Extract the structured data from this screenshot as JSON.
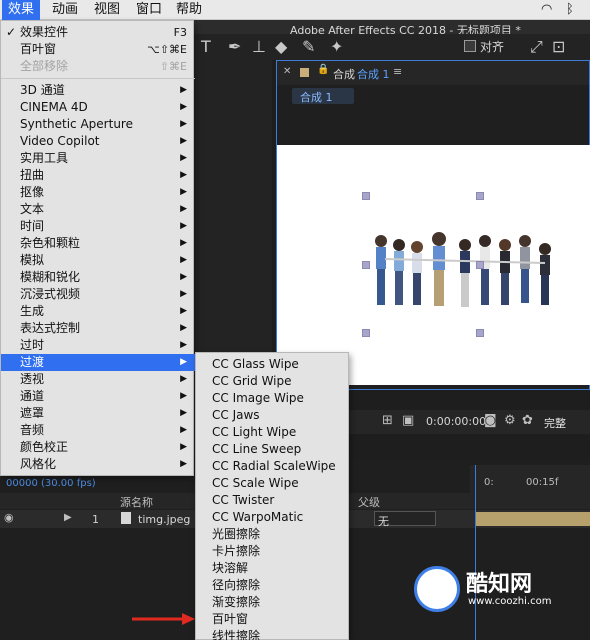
{
  "menubar": {
    "items": [
      "效果",
      "动画",
      "视图",
      "窗口",
      "帮助"
    ],
    "active_index": 0,
    "right_glyphs": [
      "wifi-icon",
      "bluetooth-icon"
    ]
  },
  "window": {
    "title": "Adobe After Effects CC 2018 - 无标题项目 *"
  },
  "toolbar": {
    "align_label": "对齐",
    "align_checked": true
  },
  "effects_menu": {
    "items": [
      {
        "label": "效果控件",
        "shortcut": "F3",
        "checked": true
      },
      {
        "label": "百叶窗",
        "shortcut": "⌥⇧⌘E"
      },
      {
        "label": "全部移除",
        "shortcut": "⇧⌘E",
        "disabled": true
      },
      {
        "label": "3D 通道",
        "submenu": true
      },
      {
        "label": "CINEMA 4D",
        "submenu": true
      },
      {
        "label": "Synthetic Aperture",
        "submenu": true
      },
      {
        "label": "Video Copilot",
        "submenu": true
      },
      {
        "label": "实用工具",
        "submenu": true
      },
      {
        "label": "扭曲",
        "submenu": true
      },
      {
        "label": "抠像",
        "submenu": true
      },
      {
        "label": "文本",
        "submenu": true
      },
      {
        "label": "时间",
        "submenu": true
      },
      {
        "label": "杂色和颗粒",
        "submenu": true
      },
      {
        "label": "模拟",
        "submenu": true
      },
      {
        "label": "模糊和锐化",
        "submenu": true
      },
      {
        "label": "沉浸式视频",
        "submenu": true
      },
      {
        "label": "生成",
        "submenu": true
      },
      {
        "label": "表达式控制",
        "submenu": true
      },
      {
        "label": "过时",
        "submenu": true
      },
      {
        "label": "过渡",
        "submenu": true,
        "highlighted": true
      },
      {
        "label": "透视",
        "submenu": true
      },
      {
        "label": "通道",
        "submenu": true
      },
      {
        "label": "遮罩",
        "submenu": true
      },
      {
        "label": "音频",
        "submenu": true
      },
      {
        "label": "颜色校正",
        "submenu": true
      },
      {
        "label": "风格化",
        "submenu": true
      }
    ]
  },
  "transition_submenu": {
    "items": [
      "CC Glass Wipe",
      "CC Grid Wipe",
      "CC Image Wipe",
      "CC Jaws",
      "CC Light Wipe",
      "CC Line Sweep",
      "CC Radial ScaleWipe",
      "CC Scale Wipe",
      "CC Twister",
      "CC WarpoMatic",
      "光圈擦除",
      "卡片擦除",
      "块溶解",
      "径向擦除",
      "渐变擦除",
      "百叶窗",
      "线性擦除"
    ],
    "pointed_item": "百叶窗"
  },
  "comp_panel": {
    "tab_prefix": "合成",
    "tab_name": "合成 1",
    "sub_label": "合成 1",
    "time_readout": "0:00:00:00",
    "quality": "完整"
  },
  "timeline": {
    "current_time": "00000 (30.00 fps)",
    "source_header": "源名称",
    "parent_header": "父级",
    "layer_number": "1",
    "layer_name": "timg.jpeg",
    "parent_value": "无",
    "ruler_start": "0:",
    "ruler_mark": "00:15f"
  },
  "watermark": {
    "name": "酷知网",
    "url": "www.coozhi.com"
  },
  "colors": {
    "menu_highlight": "#2f6ff0",
    "accent_blue": "#3d7bd6",
    "arrow_red": "#e02a1f"
  }
}
